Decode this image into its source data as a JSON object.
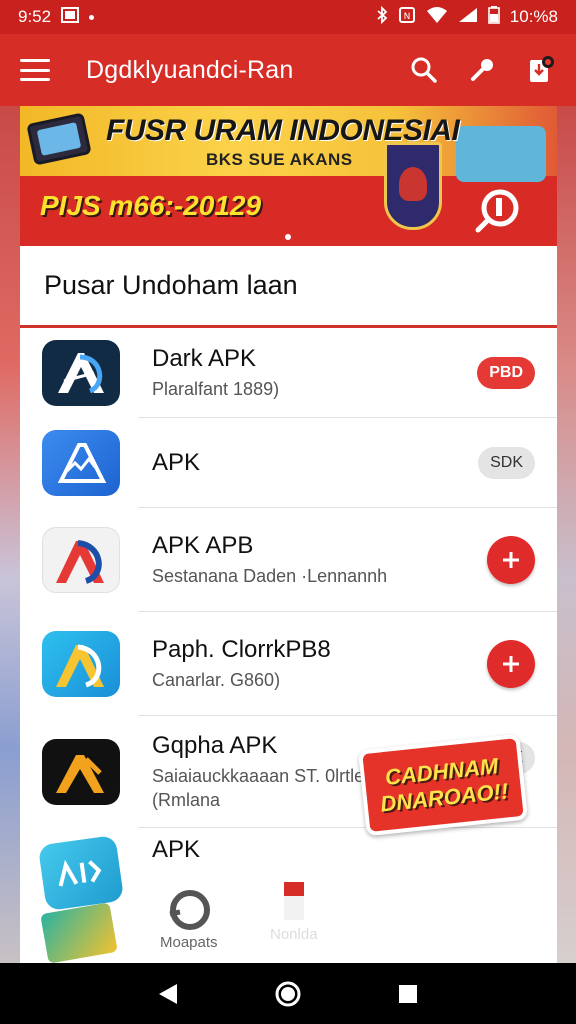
{
  "status_bar": {
    "time": "9:52",
    "clock": "10:%8"
  },
  "app_bar": {
    "title": "Dgdklyuandci-Ran",
    "icons": [
      "menu-icon",
      "search-icon",
      "wrench-icon",
      "download-icon"
    ]
  },
  "banner": {
    "title": "FUSR URAM INDONESIAI",
    "subtitle": "BKS SUE AKANS",
    "date": "PIJS m66:-20129"
  },
  "section": {
    "title": "Pusar Undoham laan"
  },
  "apps": [
    {
      "name": "Dark APK",
      "meta": "Plaralfant 1889)",
      "action": "PBD",
      "action_type": "pill-red",
      "icon_colors": [
        "#16344f",
        "#0b1a2b"
      ]
    },
    {
      "name": "APK",
      "meta": "",
      "action": "SDK",
      "action_type": "pill-gray",
      "icon_colors": [
        "#2f7de6",
        "#1a5cc0"
      ]
    },
    {
      "name": "APK APB",
      "meta": "Sestanana Daden ·Lennannh",
      "action": "",
      "action_type": "plus",
      "icon_colors": [
        "#f4f4f4",
        "#e0e0e0"
      ]
    },
    {
      "name": "Paph. ClorrkPB8",
      "meta": "Canarlar. G860)",
      "action": "",
      "action_type": "plus",
      "icon_colors": [
        "#29b6e8",
        "#1d8fd8"
      ]
    },
    {
      "name": "Gqpha APK",
      "meta": "Saiaiauckkaaaan ST. 0lrtlenokan (Rmlana",
      "action": "SPK",
      "action_type": "pill-gray",
      "icon_colors": [
        "#1a1a1a",
        "#000000"
      ]
    },
    {
      "name": "APK",
      "meta": "",
      "action": "",
      "action_type": "none",
      "icon_colors": [
        "#3ec4e8",
        "#20a0d0"
      ]
    }
  ],
  "bottom_nav": {
    "item1": "Moapats",
    "item2": "Nonlda"
  },
  "promo": {
    "line1": "CADHNAM",
    "line2": "DNAROAO!!"
  },
  "colors": {
    "primary": "#d72d27",
    "status": "#c8211e",
    "accent_yellow": "#ffe230"
  }
}
